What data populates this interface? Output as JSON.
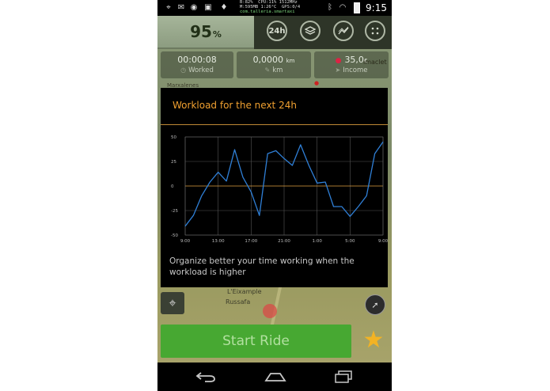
{
  "status_bar": {
    "time": "9:15",
    "sysinfo_line1": "B:82%  CPU:11% 1512MHz",
    "sysinfo_line2": "M:595MB 1:26°C  GPS:0/4",
    "sysinfo_line3": "com.talleria.smartaxi"
  },
  "top_bar": {
    "percent_value": "95",
    "percent_unit": "%",
    "buttons": [
      {
        "name": "24h-button",
        "label": "24h"
      },
      {
        "name": "layers-button",
        "icon": "layers-icon"
      },
      {
        "name": "trend-button",
        "icon": "trend-icon"
      },
      {
        "name": "menu-button",
        "icon": "dots-grid-icon"
      }
    ]
  },
  "stats": {
    "worked_value": "00:00:08",
    "worked_label": "Worked",
    "km_value": "0,0000",
    "km_unit": "km",
    "km_label": "km",
    "income_value": "35,0",
    "income_unit": "€",
    "income_label": "Income"
  },
  "map_labels": {
    "top_left": "Marxalenes",
    "top_right": "imaclet",
    "bottom_left1": "L'Eixample",
    "bottom_left2": "Russafa"
  },
  "dialog": {
    "title": "Workload for the next 24h",
    "message": "Organize better your time working when the workload is higher"
  },
  "chart_data": {
    "type": "line",
    "title": "",
    "xlabel": "",
    "ylabel": "",
    "ylim": [
      -50,
      50
    ],
    "yticks": [
      50,
      25,
      0,
      -25,
      -50
    ],
    "xtick_labels": [
      "9:00",
      "13:00",
      "17:00",
      "21:00",
      "1:00",
      "5:00",
      "9:00"
    ],
    "grid": true,
    "series": [
      {
        "color": "#2f7fd6",
        "x": [
          0,
          1,
          2,
          3,
          4,
          5,
          6,
          7,
          8,
          9,
          10,
          11,
          12,
          13,
          14,
          15,
          16,
          17,
          18,
          19,
          20,
          21,
          22,
          23,
          24
        ],
        "values": [
          -41,
          -30,
          -10,
          4,
          14,
          5,
          37,
          9,
          -6,
          -30,
          33,
          36,
          28,
          21,
          42,
          21,
          3,
          4,
          -21,
          -21,
          -31,
          -21,
          -10,
          33,
          45
        ]
      }
    ],
    "zero_line_color": "#e0a040"
  },
  "start_button": {
    "label": "Start Ride"
  },
  "colors": {
    "accent_orange": "#f0a030",
    "start_green": "#47a832",
    "star_yellow": "#f3b324",
    "series_blue": "#2f7fd6"
  }
}
